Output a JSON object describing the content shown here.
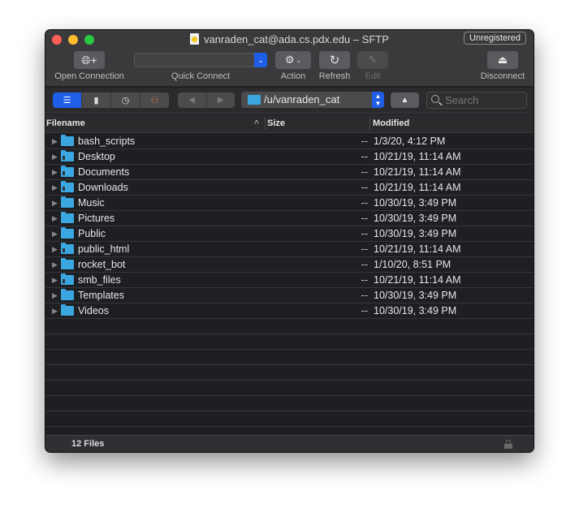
{
  "window": {
    "title": "vanraden_cat@ada.cs.pdx.edu – SFTP",
    "badge": "Unregistered"
  },
  "toolbar": {
    "open_connection": "Open Connection",
    "quick_connect": "Quick Connect",
    "quick_connect_value": "",
    "action": "Action",
    "refresh": "Refresh",
    "edit": "Edit",
    "disconnect": "Disconnect"
  },
  "navbar": {
    "view_modes": [
      "browser",
      "bookmarks",
      "history",
      "bonjour"
    ],
    "active_view": "browser",
    "path": "/u/vanraden_cat",
    "search_placeholder": "Search"
  },
  "columns": {
    "filename": "Filename",
    "size": "Size",
    "modified": "Modified",
    "sort_indicator": "^"
  },
  "files": [
    {
      "name": "bash_scripts",
      "size": "--",
      "modified": "1/3/20, 4:12 PM",
      "symlink": false
    },
    {
      "name": "Desktop",
      "size": "--",
      "modified": "10/21/19, 11:14 AM",
      "symlink": true
    },
    {
      "name": "Documents",
      "size": "--",
      "modified": "10/21/19, 11:14 AM",
      "symlink": true
    },
    {
      "name": "Downloads",
      "size": "--",
      "modified": "10/21/19, 11:14 AM",
      "symlink": true
    },
    {
      "name": "Music",
      "size": "--",
      "modified": "10/30/19, 3:49 PM",
      "symlink": false
    },
    {
      "name": "Pictures",
      "size": "--",
      "modified": "10/30/19, 3:49 PM",
      "symlink": false
    },
    {
      "name": "Public",
      "size": "--",
      "modified": "10/30/19, 3:49 PM",
      "symlink": false
    },
    {
      "name": "public_html",
      "size": "--",
      "modified": "10/21/19, 11:14 AM",
      "symlink": true
    },
    {
      "name": "rocket_bot",
      "size": "--",
      "modified": "1/10/20, 8:51 PM",
      "symlink": false
    },
    {
      "name": "smb_files",
      "size": "--",
      "modified": "10/21/19, 11:14 AM",
      "symlink": true
    },
    {
      "name": "Templates",
      "size": "--",
      "modified": "10/30/19, 3:49 PM",
      "symlink": false
    },
    {
      "name": "Videos",
      "size": "--",
      "modified": "10/30/19, 3:49 PM",
      "symlink": false
    }
  ],
  "status": {
    "count": "12 Files"
  },
  "colors": {
    "accent": "#1f5ee6",
    "folder": "#3aa7e0"
  }
}
